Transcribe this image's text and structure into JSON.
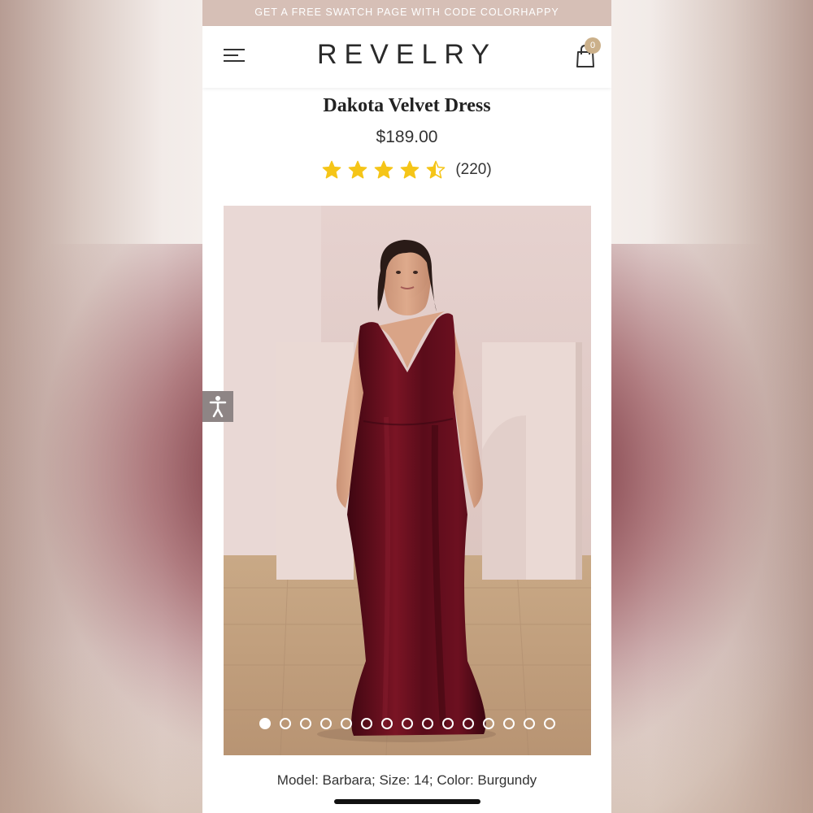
{
  "promo": {
    "text": "GET A FREE SWATCH PAGE WITH CODE COLORHAPPY"
  },
  "header": {
    "logo": "REVELRY",
    "cart_count": "0"
  },
  "product": {
    "title": "Dakota Velvet Dress",
    "price": "$189.00",
    "rating": 4.5,
    "rating_max": 5,
    "reviews": "(220)",
    "caption": "Model: Barbara; Size: 14; Color: Burgundy"
  },
  "gallery": {
    "image_count": 15,
    "active_index": 0
  },
  "colors": {
    "promo_bg": "#d6bfb6",
    "star": "#f5c518",
    "badge": "#cbb08a",
    "dress": "#5e0d1c"
  },
  "icons": {
    "menu": "menu-icon",
    "cart": "shopping-bag-icon",
    "accessibility": "accessibility-icon",
    "star": "star-icon"
  }
}
